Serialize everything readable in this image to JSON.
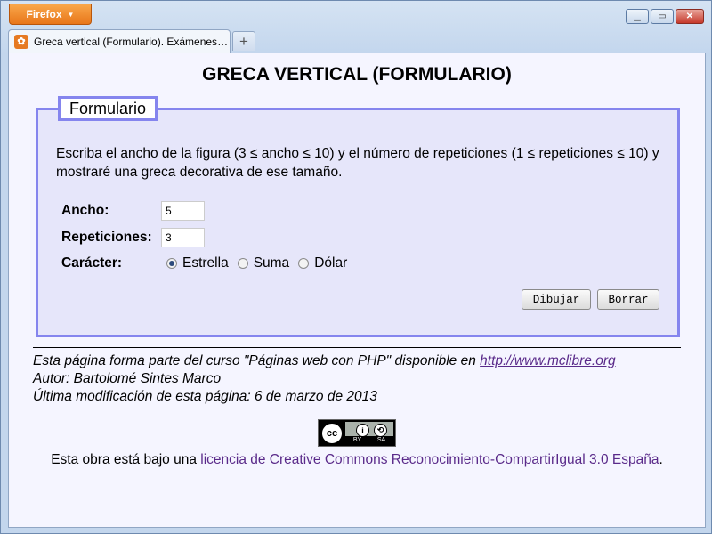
{
  "browser": {
    "menu_button": "Firefox",
    "tab_title": "Greca vertical (Formulario). Exámenes. P...",
    "new_tab_symbol": "+",
    "controls": {
      "minimize": "▁",
      "maximize": "▭",
      "close": "✕"
    }
  },
  "page": {
    "title": "GRECA VERTICAL (FORMULARIO)",
    "form": {
      "legend": "Formulario",
      "instructions": "Escriba el ancho de la figura (3 ≤ ancho ≤ 10) y el número de repeticiones (1 ≤ repeticiones ≤ 10) y mostraré una greca decorativa de ese tamaño.",
      "fields": {
        "ancho": {
          "label": "Ancho:",
          "value": "5"
        },
        "repeticiones": {
          "label": "Repeticiones:",
          "value": "3"
        },
        "caracter": {
          "label": "Carácter:",
          "options": [
            "Estrella",
            "Suma",
            "Dólar"
          ],
          "selected": "Estrella"
        }
      },
      "buttons": {
        "draw": "Dibujar",
        "clear": "Borrar"
      }
    },
    "footer": {
      "line1_text": "Esta página forma parte del curso \"Páginas web con PHP\" disponible en ",
      "line1_link": "http://www.mclibre.org",
      "line2": "Autor: Bartolomé Sintes Marco",
      "line3": "Última modificación de esta página: 6 de marzo de 2013"
    },
    "license": {
      "badge": {
        "cc": "cc",
        "by_symbol": "i",
        "sa_symbol": "⟲",
        "by": "BY",
        "sa": "SA"
      },
      "text": "Esta obra está bajo una ",
      "link": "licencia de Creative Commons Reconocimiento-CompartirIgual 3.0 España",
      "suffix": "."
    }
  }
}
